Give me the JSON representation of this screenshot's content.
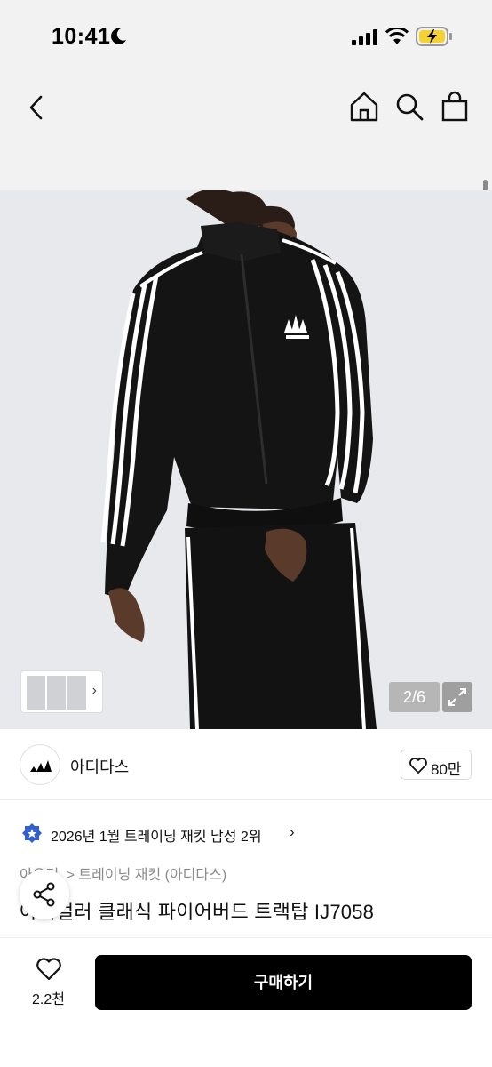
{
  "status": {
    "time": "10:41"
  },
  "gallery": {
    "counter": "2/6"
  },
  "brand": {
    "name": "아디다스",
    "likes": "80만"
  },
  "ranking": {
    "text": "2026년 1월 트레이닝 재킷 남성 2위"
  },
  "breadcrumb": {
    "items": [
      "아우터",
      "> 트레이닝 재킷 (아디다스)"
    ]
  },
  "product": {
    "title": "아디컬러 클래식 파이어버드 트랙탑 IJ7058"
  },
  "bottom": {
    "wish_count": "2.2천",
    "buy_label": "구매하기"
  },
  "colors": {
    "buy_button": "#000000",
    "nav_bg": "#f2f2f2",
    "rank_badge": "#2f5fd0",
    "battery": "#f5d131"
  }
}
